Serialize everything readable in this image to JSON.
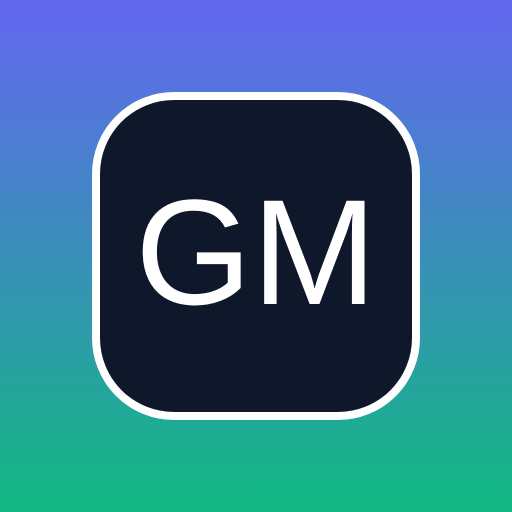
{
  "monogram": {
    "text": "GM"
  },
  "colors": {
    "gradient_top": "#6366f1",
    "gradient_bottom": "#10b981",
    "tile_fill": "#0f172a",
    "tile_border": "#ffffff",
    "text": "#ffffff"
  }
}
